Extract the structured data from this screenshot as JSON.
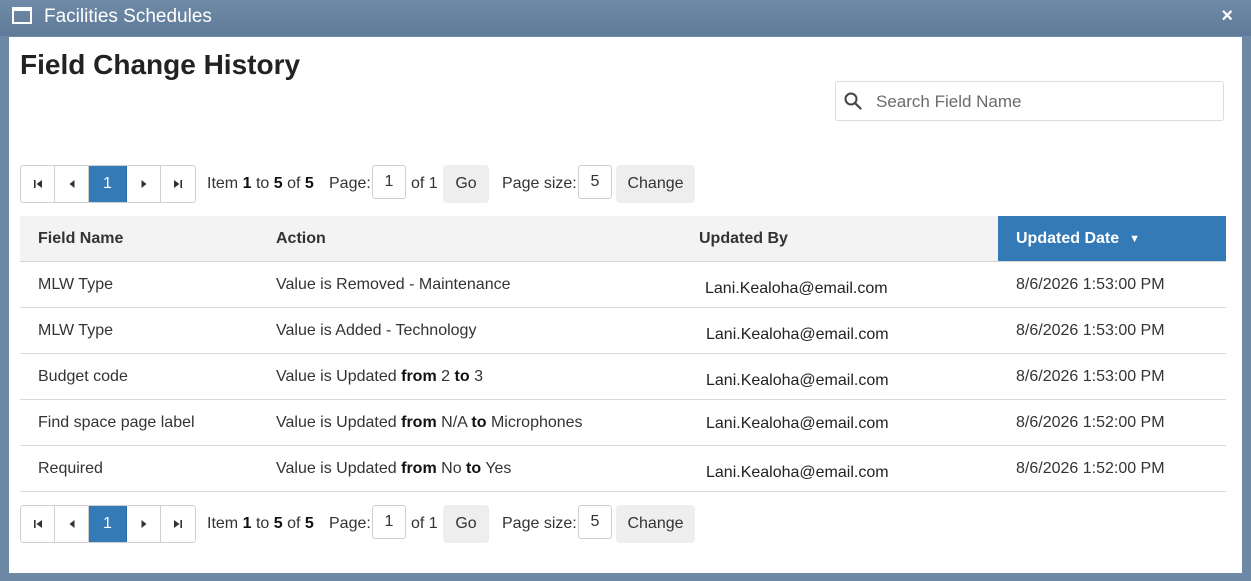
{
  "window": {
    "title": "Facilities Schedules",
    "close_label": "×"
  },
  "page": {
    "title": "Field Change History"
  },
  "search": {
    "placeholder": "Search Field Name",
    "value": ""
  },
  "pager": {
    "current_page_label": "1",
    "item_label": "Item",
    "item_from": "1",
    "to_label": "to",
    "item_to": "5",
    "of_label": "of",
    "item_total": "5",
    "page_label": "Page:",
    "page_value": "1",
    "of_pages_label": "of 1",
    "go_label": "Go",
    "page_size_label": "Page size:",
    "page_size_value": "5",
    "change_label": "Change"
  },
  "table": {
    "columns": {
      "field_name": "Field Name",
      "action": "Action",
      "updated_by": "Updated By",
      "updated_date": "Updated Date"
    },
    "sort_indicator": "▼",
    "words": {
      "from": "from",
      "to": "to"
    },
    "rows": [
      {
        "field_name": "MLW Type",
        "action_prefix": "Value is Removed - Maintenance",
        "updated_by": "Lani.Kealoha@email.com",
        "updated_date": "8/6/2026 1:53:00 PM"
      },
      {
        "field_name": "MLW Type",
        "action_prefix": "Value is Added - Technology",
        "updated_by": "Lani.Kealoha@email.com",
        "updated_date": "8/6/2026 1:53:00 PM"
      },
      {
        "field_name": "Budget code",
        "action_prefix": "Value is Updated",
        "from_value": "2",
        "to_value": "3",
        "updated_by": "Lani.Kealoha@email.com",
        "updated_date": "8/6/2026 1:53:00 PM"
      },
      {
        "field_name": "Find space page label",
        "action_prefix": "Value is Updated",
        "from_value": "N/A",
        "to_value": "Microphones",
        "updated_by": "Lani.Kealoha@email.com",
        "updated_date": "8/6/2026 1:52:00 PM"
      },
      {
        "field_name": "Required",
        "action_prefix": "Value is Updated",
        "from_value": "No",
        "to_value": "Yes",
        "updated_by": "Lani.Kealoha@email.com",
        "updated_date": "8/6/2026 1:52:00 PM"
      }
    ]
  },
  "colors": {
    "accent": "#337ab7",
    "titlebar": "#6f8aa6",
    "header_bg": "#f3f3f3"
  }
}
